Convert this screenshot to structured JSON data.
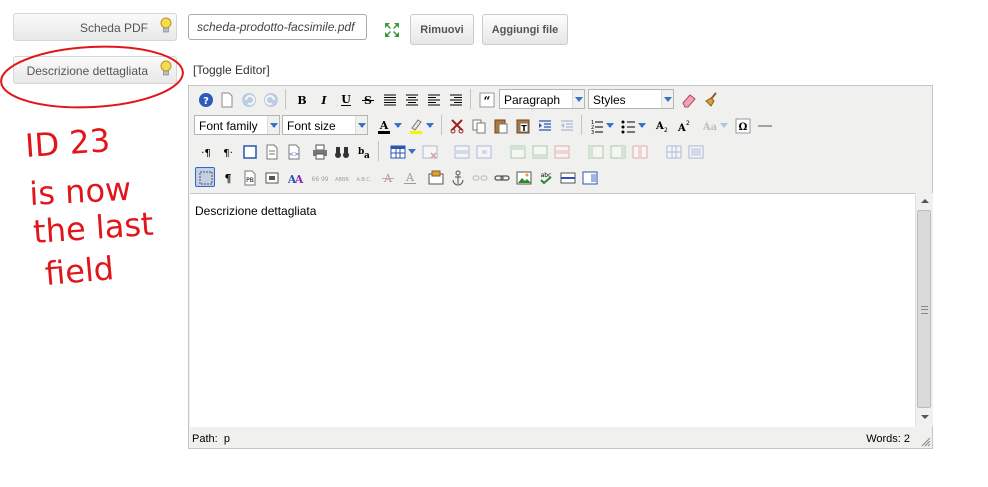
{
  "fields": {
    "pdf_label": "Scheda PDF",
    "description_label": "Descrizione dettagliata"
  },
  "file": {
    "name": "scheda-prodotto-facsimile.pdf",
    "remove_label": "Rimuovi",
    "add_label": "Aggiungi file"
  },
  "editor": {
    "toggle_label": "[Toggle Editor]",
    "format_select": "Paragraph",
    "styles_select": "Styles",
    "font_family_select": "Font family",
    "font_size_select": "Font size",
    "content_text": "Descrizione dettagliata",
    "status_path_label": "Path:",
    "status_path_value": "p",
    "status_words": "Words: 2"
  },
  "annotation": {
    "lines": [
      "ID 23",
      "is now",
      "the last",
      "field"
    ],
    "color": "#e0161b"
  },
  "colors": {
    "link_blue": "#3c70c8",
    "toolbar_bg": "#f0f0ee"
  }
}
